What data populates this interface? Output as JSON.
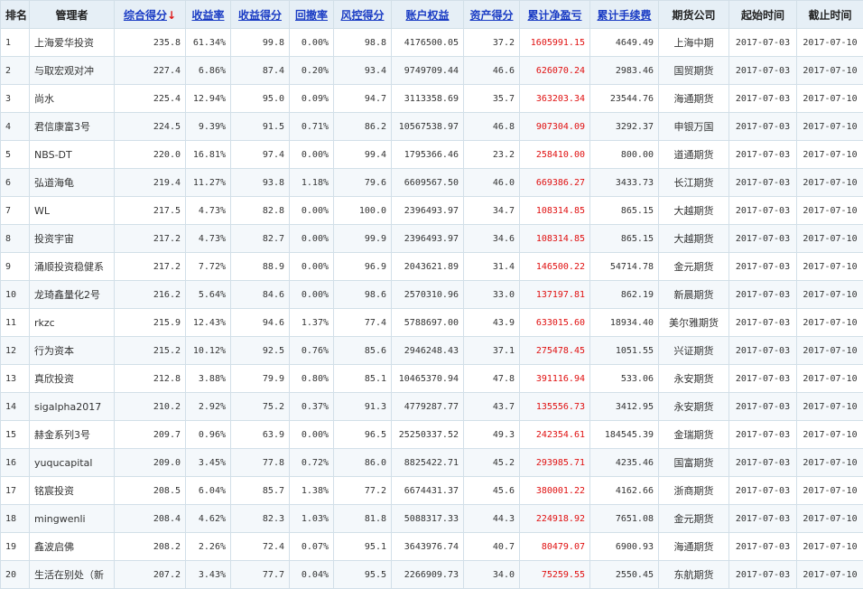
{
  "headers": {
    "rank": "排名",
    "manager": "管理者",
    "score": "综合得分",
    "sort_arrow": "↓",
    "return_rate": "收益率",
    "return_score": "收益得分",
    "drawdown": "回撤率",
    "risk_score": "风控得分",
    "equity": "账户权益",
    "asset_score": "资产得分",
    "net_pnl": "累计净盈亏",
    "fees": "累计手续费",
    "broker": "期货公司",
    "start": "起始时间",
    "end": "截止时间"
  },
  "colors": {
    "link": "#1a3cc4",
    "profit": "#e01010",
    "header_bg": "#e6eff6",
    "border": "#d2dfe8"
  },
  "rows": [
    {
      "rank": "1",
      "manager": "上海爱华投资",
      "score": "235.8",
      "return_rate": "61.34%",
      "return_score": "99.8",
      "drawdown": "0.00%",
      "risk_score": "98.8",
      "equity": "4176500.05",
      "asset_score": "37.2",
      "net_pnl": "1605991.15",
      "fees": "4649.49",
      "broker": "上海中期",
      "start": "2017-07-03",
      "end": "2017-07-10"
    },
    {
      "rank": "2",
      "manager": "与取宏观对冲",
      "score": "227.4",
      "return_rate": "6.86%",
      "return_score": "87.4",
      "drawdown": "0.20%",
      "risk_score": "93.4",
      "equity": "9749709.44",
      "asset_score": "46.6",
      "net_pnl": "626070.24",
      "fees": "2983.46",
      "broker": "国贸期货",
      "start": "2017-07-03",
      "end": "2017-07-10"
    },
    {
      "rank": "3",
      "manager": "尚水",
      "score": "225.4",
      "return_rate": "12.94%",
      "return_score": "95.0",
      "drawdown": "0.09%",
      "risk_score": "94.7",
      "equity": "3113358.69",
      "asset_score": "35.7",
      "net_pnl": "363203.34",
      "fees": "23544.76",
      "broker": "海通期货",
      "start": "2017-07-03",
      "end": "2017-07-10"
    },
    {
      "rank": "4",
      "manager": "君信康富3号",
      "score": "224.5",
      "return_rate": "9.39%",
      "return_score": "91.5",
      "drawdown": "0.71%",
      "risk_score": "86.2",
      "equity": "10567538.97",
      "asset_score": "46.8",
      "net_pnl": "907304.09",
      "fees": "3292.37",
      "broker": "申银万国",
      "start": "2017-07-03",
      "end": "2017-07-10"
    },
    {
      "rank": "5",
      "manager": "NBS-DT",
      "score": "220.0",
      "return_rate": "16.81%",
      "return_score": "97.4",
      "drawdown": "0.00%",
      "risk_score": "99.4",
      "equity": "1795366.46",
      "asset_score": "23.2",
      "net_pnl": "258410.00",
      "fees": "800.00",
      "broker": "道通期货",
      "start": "2017-07-03",
      "end": "2017-07-10"
    },
    {
      "rank": "6",
      "manager": "弘道海龟",
      "score": "219.4",
      "return_rate": "11.27%",
      "return_score": "93.8",
      "drawdown": "1.18%",
      "risk_score": "79.6",
      "equity": "6609567.50",
      "asset_score": "46.0",
      "net_pnl": "669386.27",
      "fees": "3433.73",
      "broker": "长江期货",
      "start": "2017-07-03",
      "end": "2017-07-10"
    },
    {
      "rank": "7",
      "manager": "WL",
      "score": "217.5",
      "return_rate": "4.73%",
      "return_score": "82.8",
      "drawdown": "0.00%",
      "risk_score": "100.0",
      "equity": "2396493.97",
      "asset_score": "34.7",
      "net_pnl": "108314.85",
      "fees": "865.15",
      "broker": "大越期货",
      "start": "2017-07-03",
      "end": "2017-07-10"
    },
    {
      "rank": "8",
      "manager": "投资宇宙",
      "score": "217.2",
      "return_rate": "4.73%",
      "return_score": "82.7",
      "drawdown": "0.00%",
      "risk_score": "99.9",
      "equity": "2396493.97",
      "asset_score": "34.6",
      "net_pnl": "108314.85",
      "fees": "865.15",
      "broker": "大越期货",
      "start": "2017-07-03",
      "end": "2017-07-10"
    },
    {
      "rank": "9",
      "manager": "涌顺投资稳健系",
      "score": "217.2",
      "return_rate": "7.72%",
      "return_score": "88.9",
      "drawdown": "0.00%",
      "risk_score": "96.9",
      "equity": "2043621.89",
      "asset_score": "31.4",
      "net_pnl": "146500.22",
      "fees": "54714.78",
      "broker": "金元期货",
      "start": "2017-07-03",
      "end": "2017-07-10"
    },
    {
      "rank": "10",
      "manager": "龙琦鑫量化2号",
      "score": "216.2",
      "return_rate": "5.64%",
      "return_score": "84.6",
      "drawdown": "0.00%",
      "risk_score": "98.6",
      "equity": "2570310.96",
      "asset_score": "33.0",
      "net_pnl": "137197.81",
      "fees": "862.19",
      "broker": "新晨期货",
      "start": "2017-07-03",
      "end": "2017-07-10"
    },
    {
      "rank": "11",
      "manager": "rkzc",
      "score": "215.9",
      "return_rate": "12.43%",
      "return_score": "94.6",
      "drawdown": "1.37%",
      "risk_score": "77.4",
      "equity": "5788697.00",
      "asset_score": "43.9",
      "net_pnl": "633015.60",
      "fees": "18934.40",
      "broker": "美尔雅期货",
      "start": "2017-07-03",
      "end": "2017-07-10"
    },
    {
      "rank": "12",
      "manager": "行为资本",
      "score": "215.2",
      "return_rate": "10.12%",
      "return_score": "92.5",
      "drawdown": "0.76%",
      "risk_score": "85.6",
      "equity": "2946248.43",
      "asset_score": "37.1",
      "net_pnl": "275478.45",
      "fees": "1051.55",
      "broker": "兴证期货",
      "start": "2017-07-03",
      "end": "2017-07-10"
    },
    {
      "rank": "13",
      "manager": "真欣投资",
      "score": "212.8",
      "return_rate": "3.88%",
      "return_score": "79.9",
      "drawdown": "0.80%",
      "risk_score": "85.1",
      "equity": "10465370.94",
      "asset_score": "47.8",
      "net_pnl": "391116.94",
      "fees": "533.06",
      "broker": "永安期货",
      "start": "2017-07-03",
      "end": "2017-07-10"
    },
    {
      "rank": "14",
      "manager": "sigalpha2017",
      "score": "210.2",
      "return_rate": "2.92%",
      "return_score": "75.2",
      "drawdown": "0.37%",
      "risk_score": "91.3",
      "equity": "4779287.77",
      "asset_score": "43.7",
      "net_pnl": "135556.73",
      "fees": "3412.95",
      "broker": "永安期货",
      "start": "2017-07-03",
      "end": "2017-07-10"
    },
    {
      "rank": "15",
      "manager": "赫金系列3号",
      "score": "209.7",
      "return_rate": "0.96%",
      "return_score": "63.9",
      "drawdown": "0.00%",
      "risk_score": "96.5",
      "equity": "25250337.52",
      "asset_score": "49.3",
      "net_pnl": "242354.61",
      "fees": "184545.39",
      "broker": "金瑞期货",
      "start": "2017-07-03",
      "end": "2017-07-10"
    },
    {
      "rank": "16",
      "manager": "yuqucapital",
      "score": "209.0",
      "return_rate": "3.45%",
      "return_score": "77.8",
      "drawdown": "0.72%",
      "risk_score": "86.0",
      "equity": "8825422.71",
      "asset_score": "45.2",
      "net_pnl": "293985.71",
      "fees": "4235.46",
      "broker": "国富期货",
      "start": "2017-07-03",
      "end": "2017-07-10"
    },
    {
      "rank": "17",
      "manager": "铭宸投资",
      "score": "208.5",
      "return_rate": "6.04%",
      "return_score": "85.7",
      "drawdown": "1.38%",
      "risk_score": "77.2",
      "equity": "6674431.37",
      "asset_score": "45.6",
      "net_pnl": "380001.22",
      "fees": "4162.66",
      "broker": "浙商期货",
      "start": "2017-07-03",
      "end": "2017-07-10"
    },
    {
      "rank": "18",
      "manager": "mingwenli",
      "score": "208.4",
      "return_rate": "4.62%",
      "return_score": "82.3",
      "drawdown": "1.03%",
      "risk_score": "81.8",
      "equity": "5088317.33",
      "asset_score": "44.3",
      "net_pnl": "224918.92",
      "fees": "7651.08",
      "broker": "金元期货",
      "start": "2017-07-03",
      "end": "2017-07-10"
    },
    {
      "rank": "19",
      "manager": "鑫波启佛",
      "score": "208.2",
      "return_rate": "2.26%",
      "return_score": "72.4",
      "drawdown": "0.07%",
      "risk_score": "95.1",
      "equity": "3643976.74",
      "asset_score": "40.7",
      "net_pnl": "80479.07",
      "fees": "6900.93",
      "broker": "海通期货",
      "start": "2017-07-03",
      "end": "2017-07-10"
    },
    {
      "rank": "20",
      "manager": "生活在别处（新",
      "score": "207.2",
      "return_rate": "3.43%",
      "return_score": "77.7",
      "drawdown": "0.04%",
      "risk_score": "95.5",
      "equity": "2266909.73",
      "asset_score": "34.0",
      "net_pnl": "75259.55",
      "fees": "2550.45",
      "broker": "东航期货",
      "start": "2017-07-03",
      "end": "2017-07-10"
    }
  ]
}
